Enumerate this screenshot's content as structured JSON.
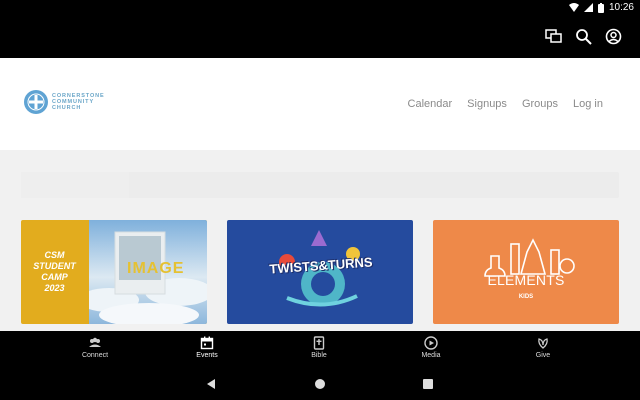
{
  "status_bar": {
    "time": "10:26",
    "icons": [
      "wifi-icon",
      "signal-icon",
      "battery-icon"
    ]
  },
  "app_bar": {
    "actions": [
      "chat-icon",
      "search-icon",
      "account-icon"
    ]
  },
  "header": {
    "logo_lines": [
      "CORNERSTONE",
      "COMMUNITY",
      "CHURCH"
    ],
    "nav": [
      "Calendar",
      "Signups",
      "Groups",
      "Log in"
    ]
  },
  "cards": [
    {
      "title_lines": [
        "CSM",
        "STUDENT",
        "CAMP",
        "2023"
      ],
      "image": "IMAGE"
    },
    {
      "title": "TWISTS&TURNS"
    },
    {
      "title": "ELEMENTS",
      "subtitle": "KIDS"
    }
  ],
  "bottom_nav": [
    {
      "label": "Connect",
      "icon": "people-icon"
    },
    {
      "label": "Events",
      "icon": "calendar-icon",
      "active": true
    },
    {
      "label": "Bible",
      "icon": "bible-icon"
    },
    {
      "label": "Media",
      "icon": "play-icon"
    },
    {
      "label": "Give",
      "icon": "give-icon"
    }
  ],
  "colors": {
    "accent": "#6aa6c8",
    "card1": "#e2ac1e",
    "card2": "#254b9e",
    "card3": "#ee8949"
  }
}
